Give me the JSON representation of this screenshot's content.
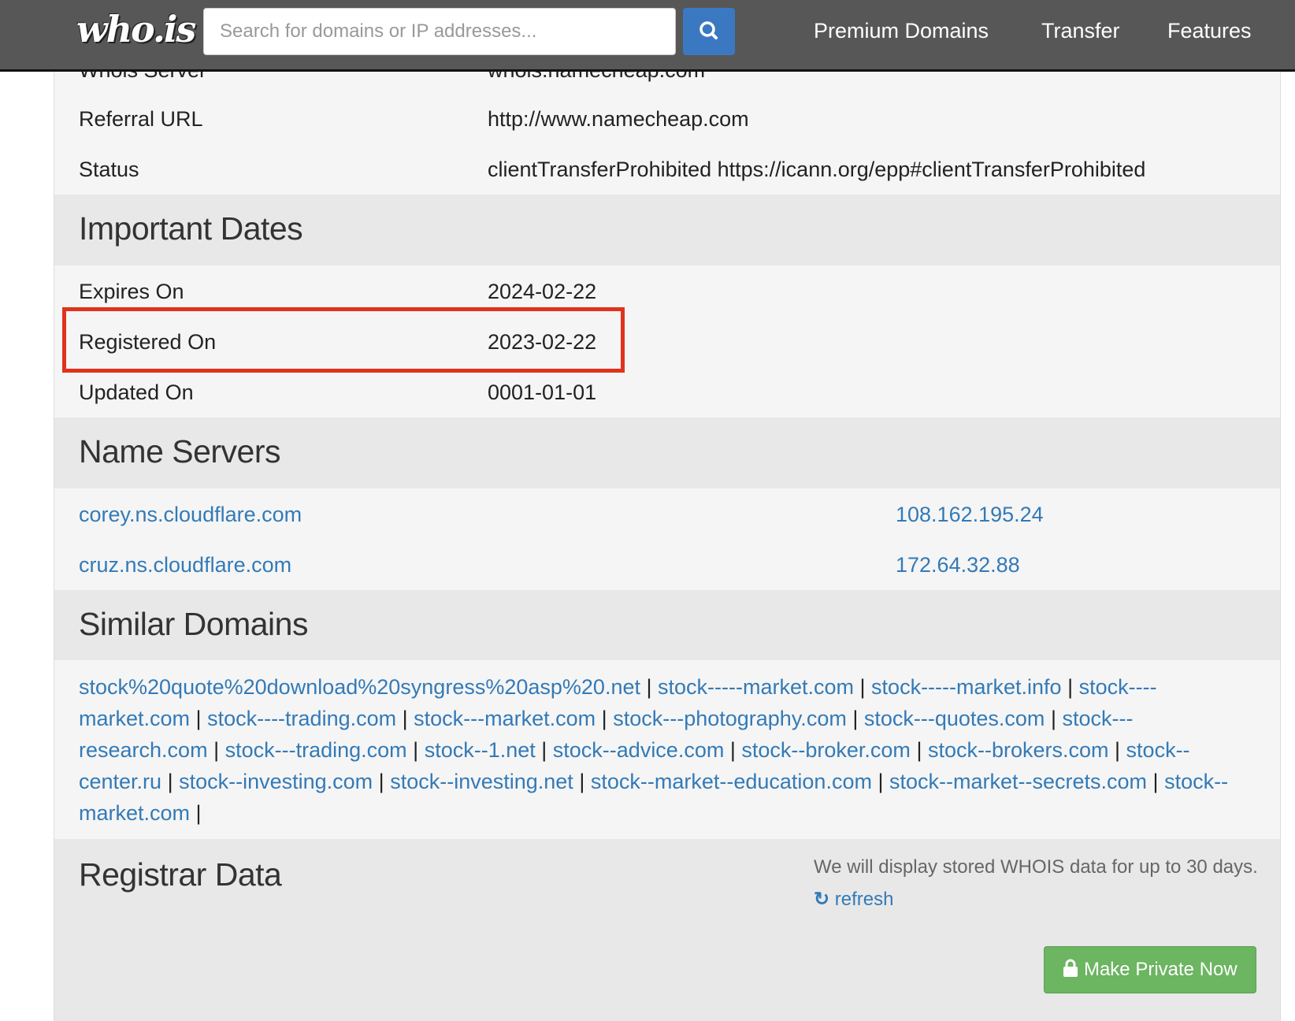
{
  "header": {
    "logo": "who.is",
    "search_placeholder": "Search for domains or IP addresses...",
    "nav": [
      "Premium Domains",
      "Transfer",
      "Features"
    ]
  },
  "registrar_info": {
    "partial_label": "Whois Server",
    "partial_value": "whois.namecheap.com",
    "rows": [
      {
        "label": "Referral URL",
        "value": "http://www.namecheap.com"
      },
      {
        "label": "Status",
        "value": "clientTransferProhibited https://icann.org/epp#clientTransferProhibited"
      }
    ]
  },
  "important_dates": {
    "title": "Important Dates",
    "rows": [
      {
        "label": "Expires On",
        "value": "2024-02-22"
      },
      {
        "label": "Registered On",
        "value": "2023-02-22"
      },
      {
        "label": "Updated On",
        "value": "0001-01-01"
      }
    ]
  },
  "name_servers": {
    "title": "Name Servers",
    "rows": [
      {
        "host": "corey.ns.cloudflare.com",
        "ip": "108.162.195.24"
      },
      {
        "host": "cruz.ns.cloudflare.com",
        "ip": "172.64.32.88"
      }
    ]
  },
  "similar_domains": {
    "title": "Similar Domains",
    "items": [
      "stock%20quote%20download%20syngress%20asp%20.net",
      "stock-----market.com",
      "stock-----market.info",
      "stock----market.com",
      "stock----trading.com",
      "stock---market.com",
      "stock---photography.com",
      "stock---quotes.com",
      "stock---research.com",
      "stock---trading.com",
      "stock--1.net",
      "stock--advice.com",
      "stock--broker.com",
      "stock--brokers.com",
      "stock--center.ru",
      "stock--investing.com",
      "stock--investing.net",
      "stock--market--education.com",
      "stock--market--secrets.com",
      "stock--market.com"
    ]
  },
  "registrar_data": {
    "title": "Registrar Data",
    "note": "We will display stored WHOIS data for up to 30 days.",
    "refresh_label": "refresh",
    "make_private_label": "Make Private Now"
  },
  "colors": {
    "link": "#337ab7",
    "highlight": "#e0321d",
    "button_green": "#6cb561",
    "header_bg": "#575757"
  }
}
